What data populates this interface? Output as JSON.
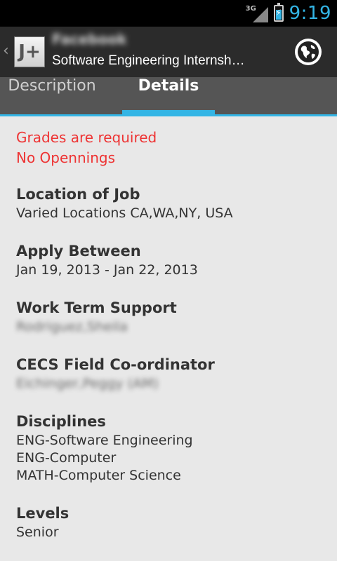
{
  "status_bar": {
    "network": "3G",
    "time": "9:19",
    "battery_level": 0.7,
    "icons": [
      "signal-icon",
      "battery-charging-icon"
    ],
    "colors": {
      "accent": "#33b5e5"
    }
  },
  "action_bar": {
    "logo_text": "J+",
    "company": "Facebook",
    "title": "Software Engineering Internsh…",
    "icons": [
      "chevron-left-icon",
      "globe-icon"
    ]
  },
  "tabs": [
    {
      "label": "Description",
      "active": false
    },
    {
      "label": "Details",
      "active": true
    }
  ],
  "alerts": [
    "Grades are required",
    "No Opennings"
  ],
  "sections": [
    {
      "label": "Location of Job",
      "values": [
        "Varied Locations CA,WA,NY, USA"
      ]
    },
    {
      "label": "Apply Between",
      "values": [
        "Jan 19, 2013 - Jan 22, 2013"
      ]
    },
    {
      "label": "Work Term Support",
      "values": [
        "Rodriguez,Sheila"
      ]
    },
    {
      "label": "CECS Field Co-ordinator",
      "values": [
        "Eichinger,Peggy (AM)"
      ]
    },
    {
      "label": "Disciplines",
      "values": [
        "ENG-Software Engineering",
        "ENG-Computer",
        "MATH-Computer Science"
      ]
    },
    {
      "label": "Levels",
      "values": [
        "Senior"
      ]
    }
  ]
}
